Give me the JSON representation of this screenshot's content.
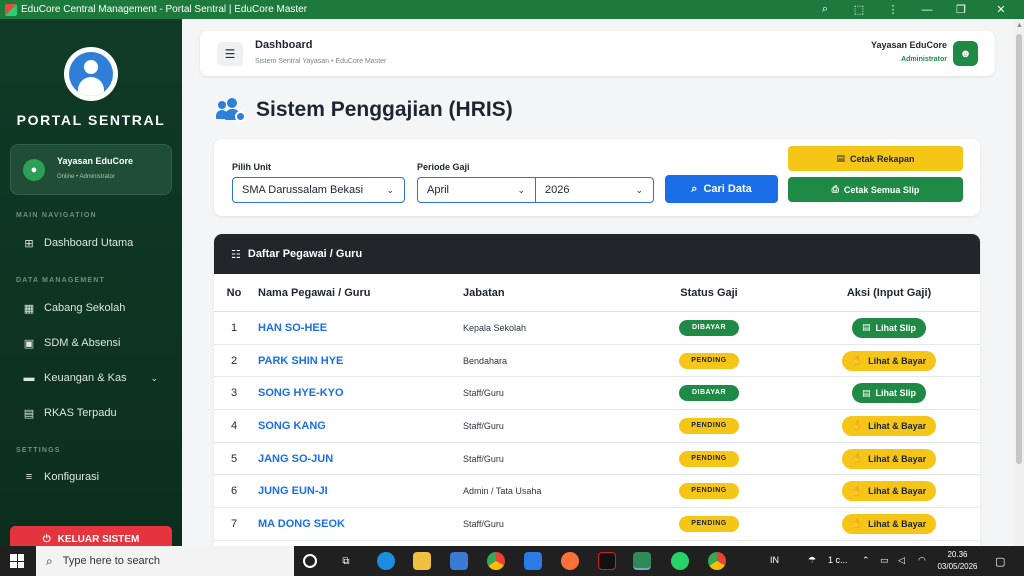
{
  "window": {
    "title": "EduCore Central Management - Portal Sentral | EduCore Master",
    "zoom_icon": "⌕",
    "ext_icon": "⬚",
    "more_icon": "⋮",
    "min_icon": "—",
    "max_icon": "❐",
    "close_icon": "✕"
  },
  "sidebar": {
    "brand": "PORTAL SENTRAL",
    "user": {
      "name": "Yayasan EduCore",
      "status": "Online • Administrator"
    },
    "sections": {
      "main": "MAIN NAVIGATION",
      "data": "DATA MANAGEMENT",
      "settings": "SETTINGS"
    },
    "items": [
      {
        "label": "Dashboard Utama",
        "icon": "⊞"
      },
      {
        "label": "Cabang Sekolah",
        "icon": "▦"
      },
      {
        "label": "SDM & Absensi",
        "icon": "▣"
      },
      {
        "label": "Keuangan & Kas",
        "icon": "▬"
      },
      {
        "label": "RKAS Terpadu",
        "icon": "▤"
      },
      {
        "label": "Konfigurasi",
        "icon": "≡"
      }
    ],
    "chevron": "⌄",
    "logout": "KELUAR SISTEM",
    "logout_icon": "⏻"
  },
  "topbar": {
    "title": "Dashboard",
    "subtitle": "Sistem Sentral Yayasan • EduCore Master",
    "user_name": "Yayasan EduCore",
    "user_role": "Administrator",
    "menu_icon": "☰",
    "avatar_icon": "☻"
  },
  "page": {
    "title": "Sistem Penggajian (HRIS)"
  },
  "filter": {
    "unit_label": "Pilih Unit",
    "unit_value": "SMA Darussalam Bekasi",
    "period_label": "Periode Gaji",
    "month_value": "April",
    "year_value": "2026",
    "dropdown_icon": "⌄",
    "search_button": "Cari Data",
    "search_icon": "⌕",
    "print_recap": "Cetak Rekapan",
    "print_recap_icon": "▤",
    "print_all": "Cetak Semua Slip",
    "print_all_icon": "⎙"
  },
  "table": {
    "title": "Daftar Pegawai / Guru",
    "title_icon": "☷",
    "columns": [
      "No",
      "Nama Pegawai / Guru",
      "Jabatan",
      "Status Gaji",
      "Aksi (Input Gaji)"
    ],
    "rows": [
      {
        "no": "1",
        "name": "HAN SO-HEE",
        "role": "Kepala Sekolah",
        "status": "DIBAYAR",
        "action": "Lihat Slip"
      },
      {
        "no": "2",
        "name": "PARK SHIN HYE",
        "role": "Bendahara",
        "status": "PENDING",
        "action": "Lihat & Bayar"
      },
      {
        "no": "3",
        "name": "SONG HYE-KYO",
        "role": "Staff/Guru",
        "status": "DIBAYAR",
        "action": "Lihat Slip"
      },
      {
        "no": "4",
        "name": "SONG KANG",
        "role": "Staff/Guru",
        "status": "PENDING",
        "action": "Lihat & Bayar"
      },
      {
        "no": "5",
        "name": "JANG SO-JUN",
        "role": "Staff/Guru",
        "status": "PENDING",
        "action": "Lihat & Bayar"
      },
      {
        "no": "6",
        "name": "JUNG EUN-JI",
        "role": "Admin / Tata Usaha",
        "status": "PENDING",
        "action": "Lihat & Bayar"
      },
      {
        "no": "7",
        "name": "MA DONG SEOK",
        "role": "Staff/Guru",
        "status": "PENDING",
        "action": "Lihat & Bayar"
      }
    ],
    "slip_icon": "▤",
    "pay_icon": "✋"
  },
  "taskbar": {
    "search_placeholder": "Type here to search",
    "search_icon": "⌕",
    "lang": "IN",
    "weather": "1 c...",
    "time": "20.36",
    "date": "03/05/2026"
  },
  "colors": {
    "sidebar": "#0f3b26",
    "primary": "#1a6fe8",
    "success": "#1f8a45",
    "warning": "#f5c518",
    "danger": "#e5343d"
  }
}
